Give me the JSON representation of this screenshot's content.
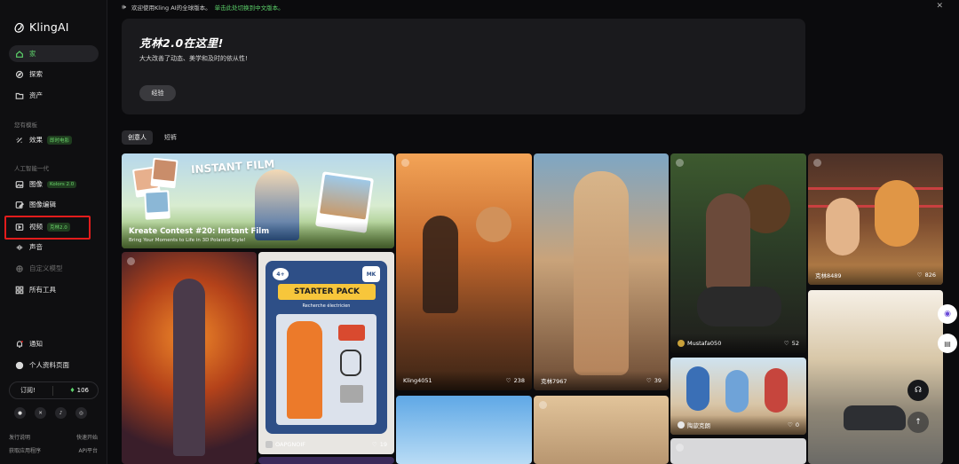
{
  "banner": {
    "text": "欢迎使用Kling AI的全球版本。",
    "link": "单击此处切换到中文版本。"
  },
  "sidebar": {
    "logo": "KlingAI",
    "primary": [
      {
        "label": "家",
        "icon": "home-icon"
      },
      {
        "label": "探索",
        "icon": "compass-icon"
      },
      {
        "label": "资产",
        "icon": "folder-icon"
      }
    ],
    "section_templates": "您有模板",
    "effects": {
      "label": "效果",
      "badge": "即时电影"
    },
    "section_ai": "人工智能一代",
    "tools": [
      {
        "label": "图像",
        "badge": "Kolors 2.0"
      },
      {
        "label": "图像编辑",
        "badge": ""
      },
      {
        "label": "视频",
        "badge": "克林2.0"
      },
      {
        "label": "声音",
        "badge": ""
      },
      {
        "label": "自定义模型",
        "badge": ""
      },
      {
        "label": "所有工具",
        "badge": ""
      }
    ],
    "notifications": "通知",
    "profile": "个人资料页面",
    "subscribe": "订阅!",
    "credits": "106",
    "footer": [
      [
        "发行说明",
        "快速开始"
      ],
      [
        "获取应用程序",
        "API平台"
      ]
    ]
  },
  "hero": {
    "title": "克林2.0在这里!",
    "subtitle": "大大改善了动态、美学和及时的依从性!",
    "button": "经验"
  },
  "tabs": [
    "创意人",
    "短裤"
  ],
  "gallery": [
    {
      "id": "contest",
      "title": "Kreate Contest #20: Instant Film",
      "subtitle": "Bring Your Moments to Life in 3D Polaroid Style!",
      "poster_text": "INSTANT FILM"
    },
    {
      "id": "kling4051",
      "user": "Kling4051",
      "likes": "238"
    },
    {
      "id": "k7967",
      "user": "克林7967",
      "likes": "39"
    },
    {
      "id": "mustafa",
      "user": "Mustafa050",
      "likes": "52"
    },
    {
      "id": "k8489",
      "user": "克林8489",
      "likes": "826"
    },
    {
      "id": "oapgnoif",
      "user": "OAPGNOIF",
      "likes": "19",
      "poster_text": "STARTER PACK",
      "poster_sub": "Recherche électricien",
      "poster_badge": "4+",
      "poster_mk": "MK"
    },
    {
      "id": "taoxin",
      "user": "陶歆克朗",
      "likes": "0"
    }
  ],
  "colors": {
    "accent": "#5dd36b",
    "highlight": "#e21c1c"
  }
}
